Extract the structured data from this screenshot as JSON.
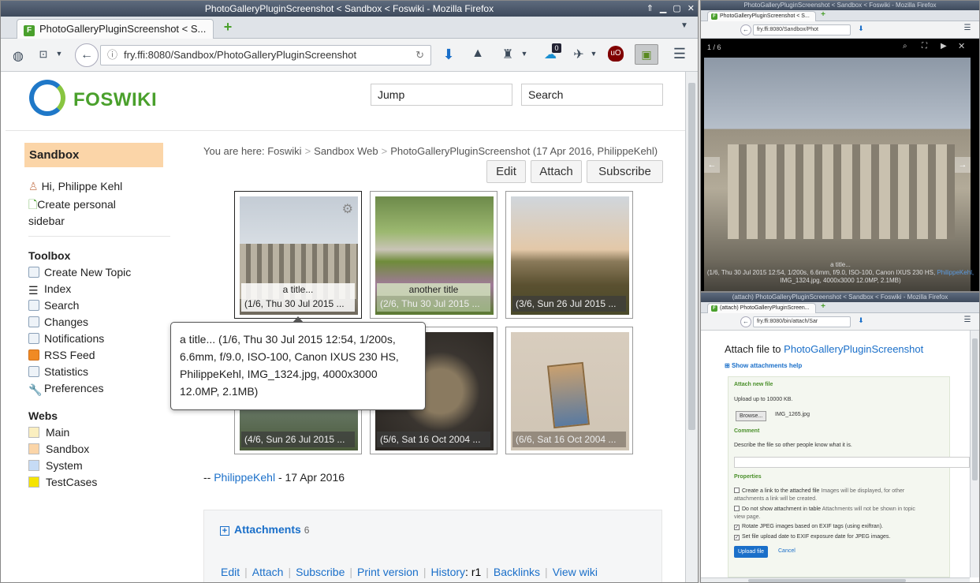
{
  "main_window": {
    "title": "PhotoGalleryPluginScreenshot < Sandbox < Foswiki - Mozilla Firefox",
    "tab_title": "PhotoGalleryPluginScreenshot < S...",
    "url": "fry.ffi:8080/Sandbox/PhotoGalleryPluginScreenshot",
    "notification_badge": "0"
  },
  "header": {
    "logo_text": "FOSWIKI",
    "jump_placeholder": "Jump",
    "search_placeholder": "Search"
  },
  "sidebar": {
    "web": "Sandbox",
    "user_greeting": "Hi, Philippe Kehl",
    "create_sidebar": "Create personal sidebar",
    "toolbox_heading": "Toolbox",
    "toolbox": [
      {
        "label": "Create New Topic",
        "icon": "new-topic-icon"
      },
      {
        "label": "Index",
        "icon": "index-icon"
      },
      {
        "label": "Search",
        "icon": "search-icon"
      },
      {
        "label": "Changes",
        "icon": "changes-icon"
      },
      {
        "label": "Notifications",
        "icon": "mail-icon"
      },
      {
        "label": "RSS Feed",
        "icon": "rss-icon"
      },
      {
        "label": "Statistics",
        "icon": "statistics-icon"
      },
      {
        "label": "Preferences",
        "icon": "wrench-icon"
      }
    ],
    "webs_heading": "Webs",
    "webs": [
      {
        "label": "Main",
        "color": "#fbefc0"
      },
      {
        "label": "Sandbox",
        "color": "#fbd5a8"
      },
      {
        "label": "System",
        "color": "#c6dbf5"
      },
      {
        "label": "TestCases",
        "color": "#f5e400"
      }
    ]
  },
  "breadcrumb": {
    "prefix": "You are here:",
    "items": [
      "Foswiki",
      "Sandbox Web",
      "PhotoGalleryPluginScreenshot (17 Apr 2016, PhilippeKehl)"
    ]
  },
  "topic_actions": {
    "edit": "Edit",
    "attach": "Attach",
    "subscribe": "Subscribe"
  },
  "gallery": [
    {
      "title": "a title...",
      "caption": "(1/6, Thu 30 Jul 2015 ..."
    },
    {
      "title": "another title",
      "caption": "(2/6, Thu 30 Jul 2015 ..."
    },
    {
      "title": "",
      "caption": "(3/6, Sun 26 Jul 2015 ..."
    },
    {
      "title": "",
      "caption": "(4/6, Sun 26 Jul 2015 ..."
    },
    {
      "title": "",
      "caption": "(5/6, Sat 16 Oct 2004 ..."
    },
    {
      "title": "",
      "caption": "(6/6, Sat 16 Oct 2004 ..."
    }
  ],
  "tooltip": {
    "text": "a title... (1/6, Thu 30 Jul 2015 12:54, 1/200s, 6.6mm, f/9.0, ISO-100, Canon IXUS 230 HS, PhilippeKehl, IMG_1324.jpg, 4000x3000 12.0MP, 2.1MB)"
  },
  "signature": {
    "prefix": "--",
    "author": "PhilippeKehl",
    "date": "- 17 Apr 2016"
  },
  "attachments": {
    "label": "Attachments",
    "count": "6"
  },
  "bottom_links": {
    "edit": "Edit",
    "attach": "Attach",
    "subscribe": "Subscribe",
    "print": "Print version",
    "history_label": "History",
    "history_rev": "r1",
    "backlinks": "Backlinks",
    "view_wiki": "View wiki"
  },
  "lightbox_window": {
    "title": "PhotoGalleryPluginScreenshot < Sandbox < Foswiki - Mozilla Firefox",
    "tab_title": "PhotoGalleryPluginScreenshot < S...",
    "url": "fry.ffi:8080/Sandbox/Phot",
    "counter": "1 / 6",
    "caption_title": "a title...",
    "caption_line1": "(1/6, Thu 30 Jul 2015 12:54, 1/200s, 6.6mm, f/9.0, ISO-100, Canon IXUS 230 HS,",
    "caption_author": "PhilippeKehl,",
    "caption_line2": "IMG_1324.jpg, 4000x3000 12.0MP, 2.1MB)"
  },
  "attach_window": {
    "title": "(attach) PhotoGalleryPluginScreenshot < Sandbox < Foswiki - Mozilla Firefox",
    "tab_title": "(attach) PhotoGalleryPluginScreen...",
    "url": "fry.ffi:8080/bin/attach/Sar",
    "heading_prefix": "Attach file to",
    "heading_topic": "PhotoGalleryPluginScreenshot",
    "help_link": "Show attachments help",
    "new_file_heading": "Attach new file",
    "upload_limit": "Upload up to 10000 KB.",
    "browse_button": "Browse...",
    "file_name": "IMG_1265.jpg",
    "comment_heading": "Comment",
    "comment_hint": "Describe the file so other people know what it is.",
    "properties_heading": "Properties",
    "opt1_strong": "Create a link to the attached file",
    "opt1_rest": "Images will be displayed, for other",
    "opt1_rest2": "attachments a link will be created.",
    "opt2_strong": "Do not show attachment in table",
    "opt2_rest": "Attachments will not be shown in topic",
    "opt2_rest2": "view page.",
    "opt3": "Rotate JPEG images based on EXIF tags (using exiftran).",
    "opt4": "Set file upload date to EXIF exposure date for JPEG images.",
    "upload_button": "Upload file",
    "cancel_link": "Cancel"
  }
}
